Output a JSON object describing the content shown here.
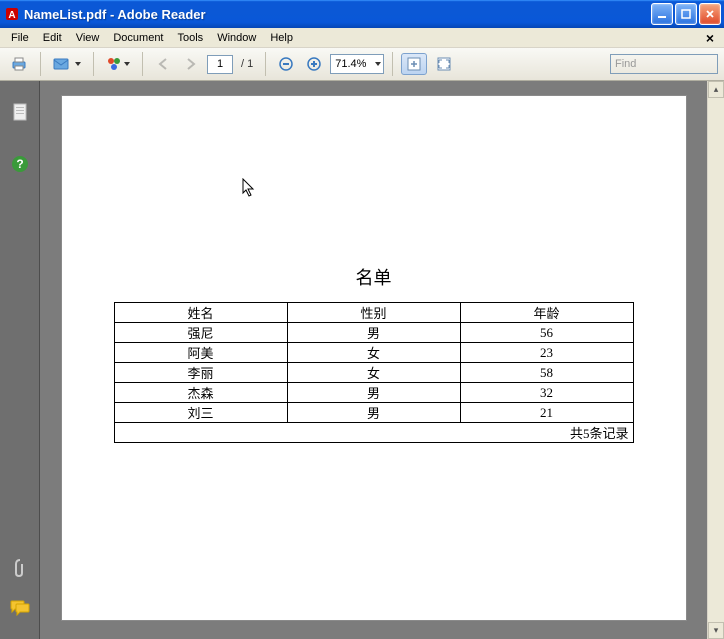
{
  "window": {
    "title": "NameList.pdf - Adobe Reader"
  },
  "menubar": {
    "file": "File",
    "edit": "Edit",
    "view": "View",
    "document": "Document",
    "tools": "Tools",
    "window": "Window",
    "help": "Help"
  },
  "toolbar": {
    "page_current": "1",
    "page_total": "/ 1",
    "zoom": "71.4%",
    "find_placeholder": "Find"
  },
  "document": {
    "title": "名单",
    "headers": {
      "name": "姓名",
      "gender": "性别",
      "age": "年龄"
    },
    "rows": [
      {
        "name": "强尼",
        "gender": "男",
        "age": "56"
      },
      {
        "name": "阿美",
        "gender": "女",
        "age": "23"
      },
      {
        "name": "李丽",
        "gender": "女",
        "age": "58"
      },
      {
        "name": "杰森",
        "gender": "男",
        "age": "32"
      },
      {
        "name": "刘三",
        "gender": "男",
        "age": "21"
      }
    ],
    "footer": "共5条记录"
  }
}
